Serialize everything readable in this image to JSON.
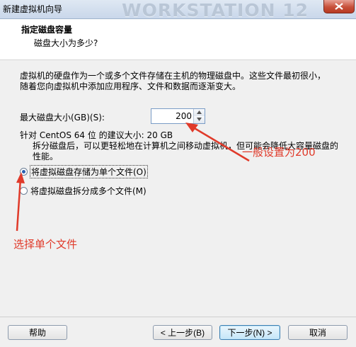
{
  "window": {
    "title": "新建虚拟机向导",
    "watermark": "WORKSTATION 12"
  },
  "header": {
    "title": "指定磁盘容量",
    "subtitle": "磁盘大小为多少?"
  },
  "content": {
    "description": "虚拟机的硬盘作为一个或多个文件存储在主机的物理磁盘中。这些文件最初很小，随着您向虚拟机中添加应用程序、文件和数据而逐渐变大。",
    "size_label": "最大磁盘大小(GB)(S):",
    "size_value": "200",
    "recommend": "针对 CentOS 64 位 的建议大小: 20 GB",
    "option_single": {
      "label": "将虚拟磁盘存储为单个文件(O)",
      "selected": true
    },
    "option_split": {
      "label": "将虚拟磁盘拆分成多个文件(M)",
      "selected": false
    },
    "split_description": "拆分磁盘后，可以更轻松地在计算机之间移动虚拟机，但可能会降低大容量磁盘的性能。"
  },
  "annotations": {
    "size_note": "一般设置为200",
    "file_note": "选择单个文件",
    "color": "#e03a2a"
  },
  "buttons": {
    "help": "帮助",
    "back": "< 上一步(B)",
    "next": "下一步(N) >",
    "cancel": "取消"
  }
}
